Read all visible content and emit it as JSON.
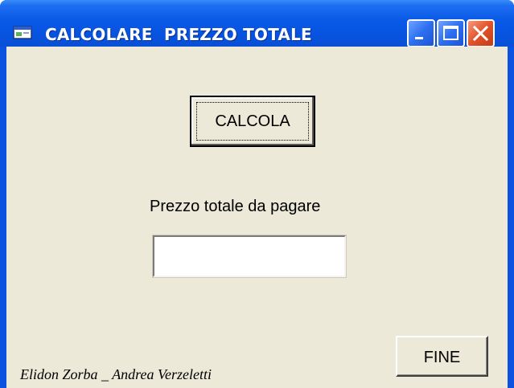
{
  "window": {
    "title": "CALCOLARE  PREZZO TOTALE",
    "app_icon": "form-window-icon",
    "controls": {
      "minimize_icon": "minimize-icon",
      "maximize_icon": "maximize-icon",
      "close_icon": "close-icon"
    },
    "colors": {
      "titlebar": "#0a58e6",
      "client_background": "#ece9d8",
      "close_button": "#e0532a"
    }
  },
  "form": {
    "calcola_button_label": "CALCOLA",
    "prezzo_label": "Prezzo totale da pagare",
    "prezzo_value": "",
    "fine_button_label": "FINE",
    "credits": "Elidon Zorba _ Andrea Verzeletti"
  }
}
